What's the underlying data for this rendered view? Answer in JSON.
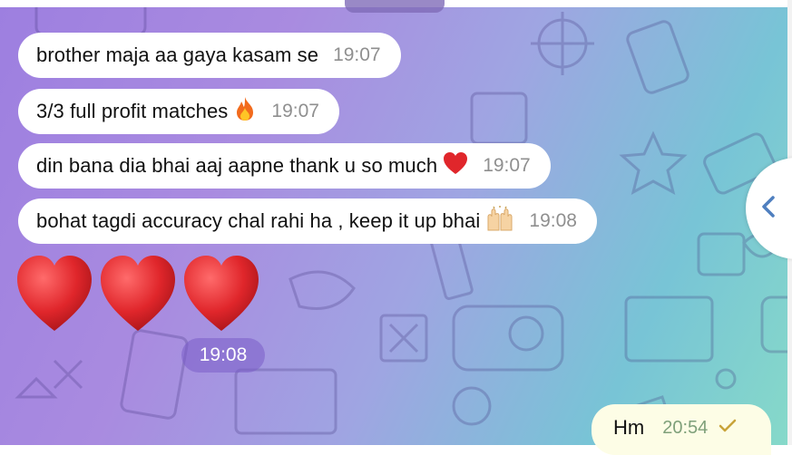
{
  "messages": [
    {
      "text": "brother maja aa gaya kasam se",
      "time": "19:07"
    },
    {
      "text": "3/3 full profit matches",
      "emoji": "fire-emoji",
      "time": "19:07"
    },
    {
      "text": "din bana dia bhai aaj aapne thank u so much",
      "emoji": "red-heart-emoji",
      "time": "19:07"
    },
    {
      "text": "bohat tagdi accuracy chal rahi ha , keep it up bhai",
      "emoji": "raising-hands-emoji",
      "time": "19:08"
    }
  ],
  "hearts_message": {
    "emoji": [
      "red-heart-emoji",
      "red-heart-emoji",
      "red-heart-emoji"
    ],
    "time": "19:08"
  },
  "outgoing_message": {
    "text": "Hm",
    "time": "20:54",
    "status_icon": "single-check-icon"
  },
  "side_button_icon": "chevron-left-icon",
  "colors": {
    "background_start": "#9d7fe0",
    "background_end": "#86d9c9",
    "incoming_bubble": "#ffffff",
    "outgoing_bubble": "#fdfde6",
    "accent": "#4f7fbf",
    "heart": "#e0262b"
  }
}
